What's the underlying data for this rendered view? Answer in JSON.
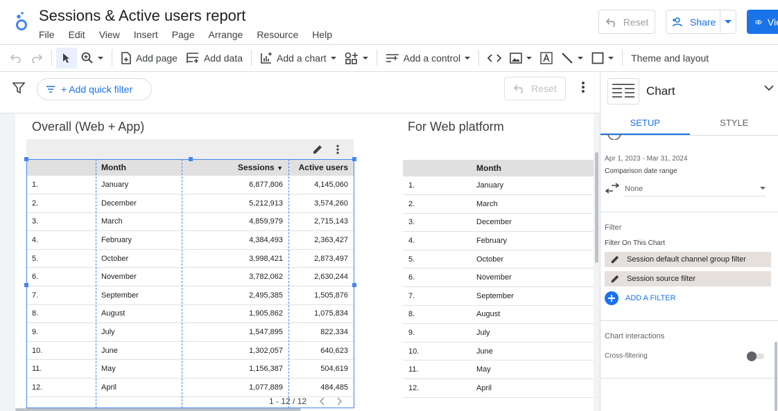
{
  "header": {
    "title": "Sessions & Active users report",
    "menu": [
      "File",
      "Edit",
      "View",
      "Insert",
      "Page",
      "Arrange",
      "Resource",
      "Help"
    ],
    "reset_label": "Reset",
    "share_label": "Share",
    "view_label": "View"
  },
  "toolbar": {
    "add_page": "Add page",
    "add_data": "Add data",
    "add_chart": "Add a chart",
    "add_control": "Add a control",
    "theme_layout": "Theme and layout"
  },
  "filterbar": {
    "quick_filter": "+ Add quick filter",
    "reset_label": "Reset"
  },
  "charts": {
    "overall": {
      "title": "Overall (Web + App)",
      "columns": [
        "Month",
        "Sessions",
        "Active users"
      ],
      "rows": [
        {
          "idx": "1.",
          "month": "January",
          "sessions": "6,877,806",
          "users": "4,145,060"
        },
        {
          "idx": "2.",
          "month": "December",
          "sessions": "5,212,913",
          "users": "3,574,260"
        },
        {
          "idx": "3.",
          "month": "March",
          "sessions": "4,859,979",
          "users": "2,715,143"
        },
        {
          "idx": "4.",
          "month": "February",
          "sessions": "4,384,493",
          "users": "2,363,427"
        },
        {
          "idx": "5.",
          "month": "October",
          "sessions": "3,998,421",
          "users": "2,873,497"
        },
        {
          "idx": "6.",
          "month": "November",
          "sessions": "3,782,062",
          "users": "2,630,244"
        },
        {
          "idx": "7.",
          "month": "September",
          "sessions": "2,495,385",
          "users": "1,505,876"
        },
        {
          "idx": "8.",
          "month": "August",
          "sessions": "1,905,862",
          "users": "1,075,834"
        },
        {
          "idx": "9.",
          "month": "July",
          "sessions": "1,547,895",
          "users": "822,334"
        },
        {
          "idx": "10.",
          "month": "June",
          "sessions": "1,302,057",
          "users": "640,623"
        },
        {
          "idx": "11.",
          "month": "May",
          "sessions": "1,156,387",
          "users": "504,619"
        },
        {
          "idx": "12.",
          "month": "April",
          "sessions": "1,077,889",
          "users": "484,485"
        }
      ],
      "pager": "1 - 12 / 12"
    },
    "web": {
      "title": "For Web platform",
      "columns": [
        "Month"
      ],
      "rows": [
        {
          "idx": "1.",
          "month": "January"
        },
        {
          "idx": "2.",
          "month": "March"
        },
        {
          "idx": "3.",
          "month": "December"
        },
        {
          "idx": "4.",
          "month": "February"
        },
        {
          "idx": "5.",
          "month": "October"
        },
        {
          "idx": "6.",
          "month": "November"
        },
        {
          "idx": "7.",
          "month": "September"
        },
        {
          "idx": "8.",
          "month": "August"
        },
        {
          "idx": "9.",
          "month": "July"
        },
        {
          "idx": "10.",
          "month": "June"
        },
        {
          "idx": "11.",
          "month": "May"
        },
        {
          "idx": "12.",
          "month": "April"
        }
      ]
    }
  },
  "panel": {
    "title": "Chart",
    "tabs": [
      "SETUP",
      "STYLE"
    ],
    "date_range": "Apr 1, 2023 - Mar 31, 2024",
    "comparison_label": "Comparison date range",
    "comparison_value": "None",
    "filter_heading": "Filter",
    "filter_on_chart": "Filter On This Chart",
    "filters": [
      "Session default channel group filter",
      "Session source filter"
    ],
    "add_filter": "ADD A FILTER",
    "interactions_heading": "Chart interactions",
    "cross_filtering": "Cross-filtering"
  },
  "colors": {
    "accent": "#1a73e8",
    "selection": "#4285f4",
    "chip_bg": "#e5e0dc"
  }
}
